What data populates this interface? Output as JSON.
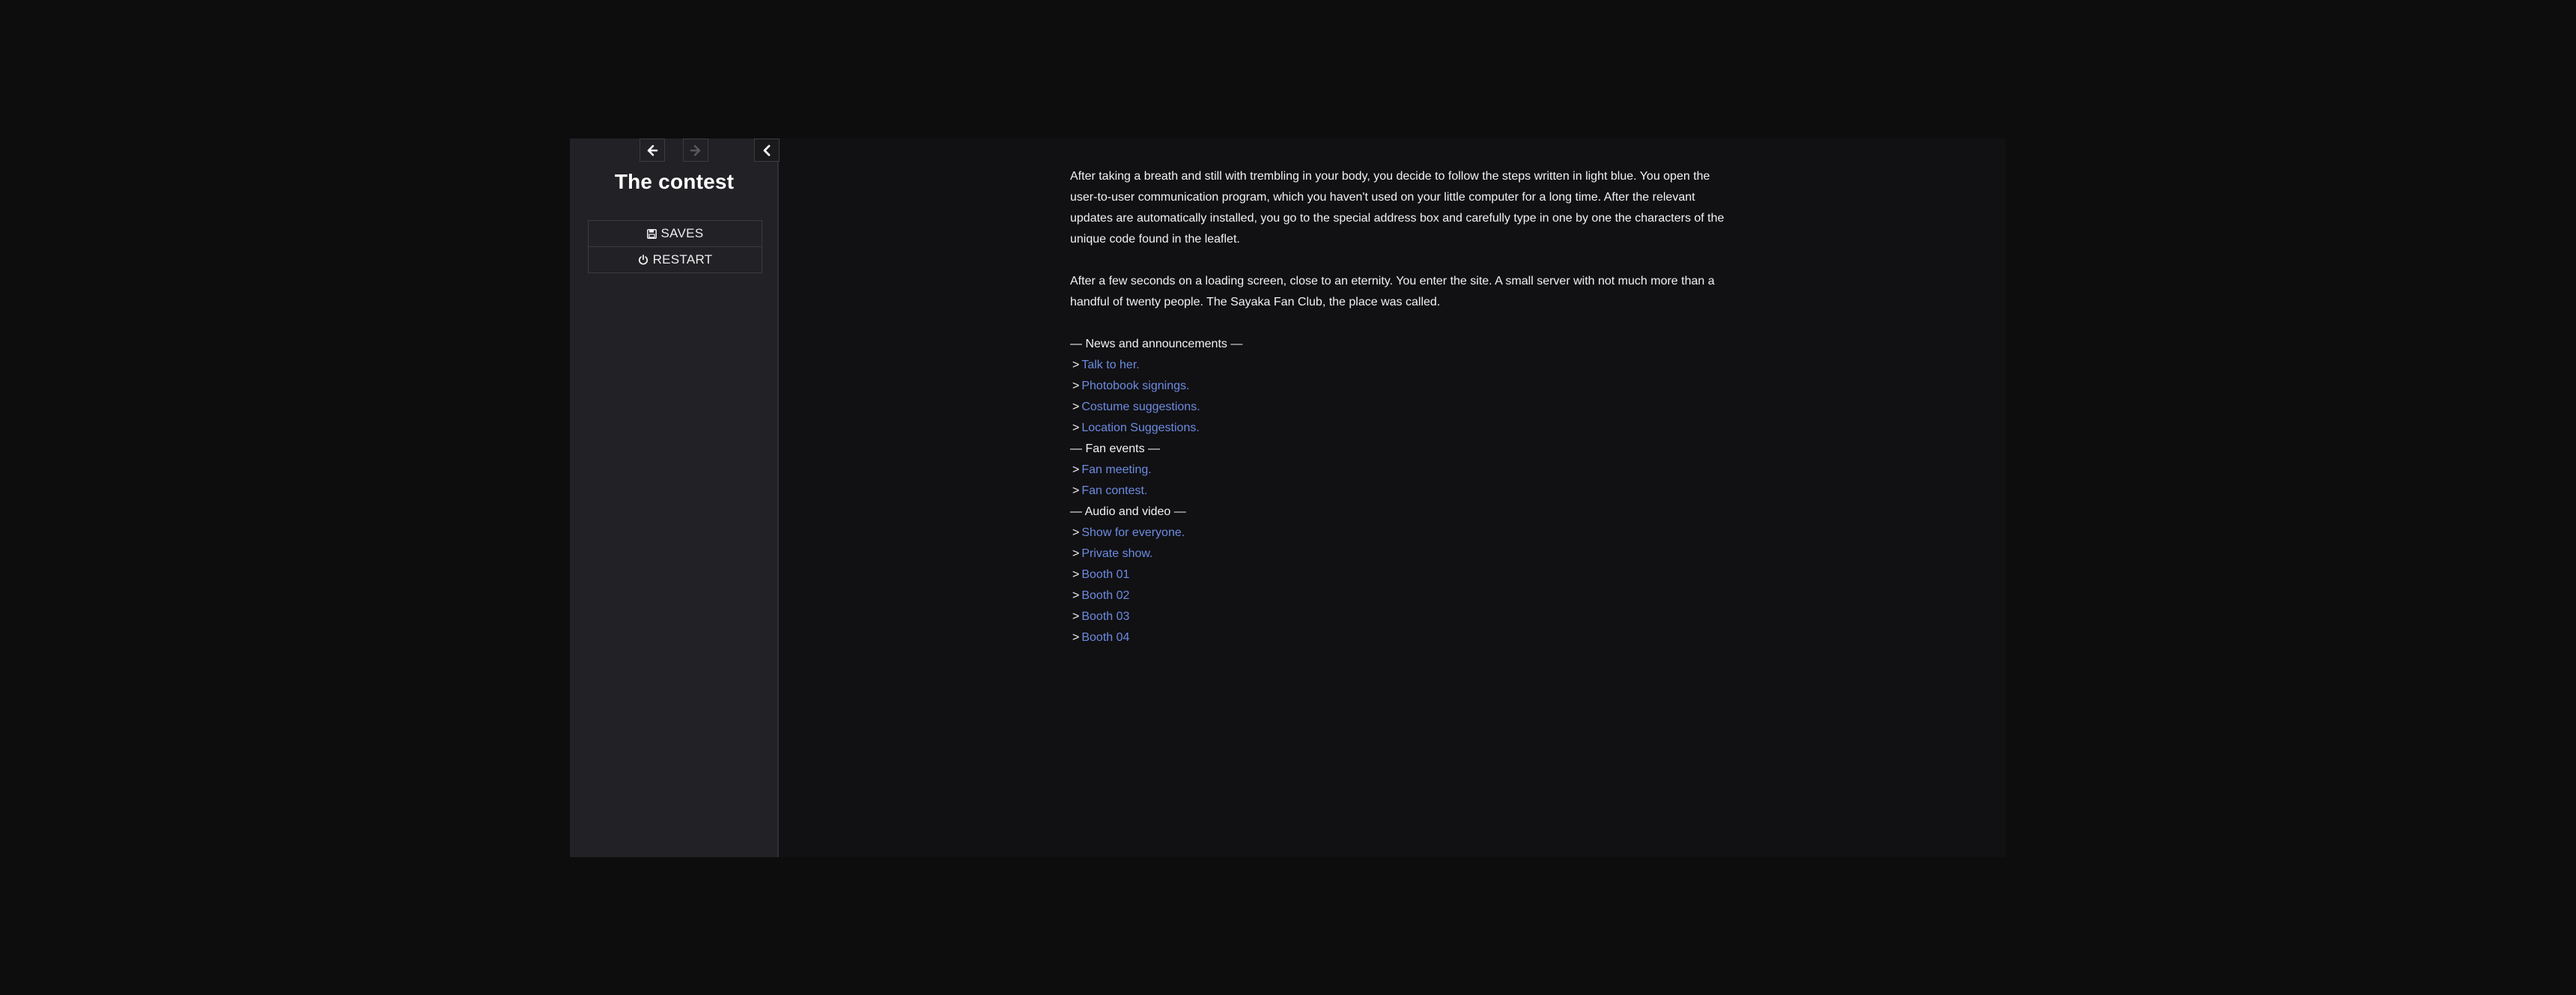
{
  "sidebar": {
    "title": "The contest",
    "menu": {
      "saves_label": "SAVES",
      "restart_label": "RESTART"
    }
  },
  "passage": {
    "paragraphs": [
      "After taking a breath and still with trembling in your body, you decide to follow the steps written in light blue. You open the user-to-user communication program, which you haven't used on your little computer for a long time. After the relevant updates are automatically installed, you go to the special address box and carefully type in one by one the characters of the unique code found in the leaflet.",
      "After a few seconds on a loading screen, close to an eternity. You enter the site. A small server with not much more than a handful of twenty people. The Sayaka Fan Club, the place was called."
    ],
    "sections": [
      {
        "header": "— News and announcements —",
        "links": [
          "Talk to her.",
          "Photobook signings.",
          "Costume suggestions.",
          "Location Suggestions."
        ]
      },
      {
        "header": "— Fan events —",
        "links": [
          "Fan meeting.",
          "Fan contest."
        ]
      },
      {
        "header": "— Audio and video —",
        "links": [
          "Show for everyone.",
          "Private show.",
          "Booth 01",
          "Booth 02",
          "Booth 03",
          "Booth 04"
        ]
      }
    ],
    "link_prefix": ">"
  },
  "colors": {
    "page_bg": "#0d0d0e",
    "story_bg": "#111013",
    "sidebar_bg": "#222125",
    "link": "#6c8ce0",
    "text": "#f2f2f2"
  },
  "icons": {
    "back": "arrow-left-icon",
    "forward": "arrow-right-icon",
    "toggle": "chevron-left-icon",
    "saves": "floppy-disk-icon",
    "restart": "power-icon"
  }
}
